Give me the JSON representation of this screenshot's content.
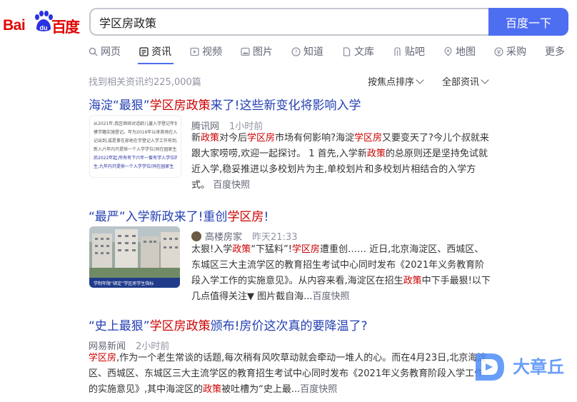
{
  "logo": {
    "text_left": "Bai",
    "text_right": "百度",
    "paw_text": "du"
  },
  "search": {
    "query": "学区房政策",
    "button_label": "百度一下"
  },
  "tabs": [
    {
      "label": "网页",
      "icon": "search-icon"
    },
    {
      "label": "资讯",
      "icon": "news-icon",
      "active": true
    },
    {
      "label": "视频",
      "icon": "video-icon"
    },
    {
      "label": "图片",
      "icon": "image-icon"
    },
    {
      "label": "知道",
      "icon": "question-icon"
    },
    {
      "label": "文库",
      "icon": "document-icon"
    },
    {
      "label": "贴吧",
      "icon": "tieba-icon"
    },
    {
      "label": "地图",
      "icon": "map-icon"
    },
    {
      "label": "采购",
      "icon": "purchase-icon"
    },
    {
      "label": "更多"
    }
  ],
  "result_count": "找到相关资讯约225,000篇",
  "sort_label": "按焦点排序",
  "filter_label": "全部资讯",
  "results": [
    {
      "title_parts": [
        "海淀“最狠”",
        "学区房政策",
        "来了!这些新变化将影响入学"
      ],
      "source": "腾讯网",
      "time": "1小时前",
      "abstract_parts": [
        "新",
        "政策",
        "对今后",
        "学区房",
        "市场有何影响?海淀",
        "学区房",
        "又要变天了?今儿个叔就来跟大家唠唠,欢迎一起探讨。 1 首先,入学新",
        "政策",
        "的总原则还是坚持免试就近入学,稳妥推进以多校划片为主,单校划片和多校划片相结合的入学方式。"
      ],
      "snapshot": "百度快照",
      "thumb_lines": [
        "从2021年,我区继续对适龄儿童入学登记年份",
        "摸学籍实施登记。年为2016年以来首地在入学登",
        "记出到,或是事在部地在学登记入学工作有到,教",
        "新入六年内只提供一个入学学位(同在园家生登记",
        "后2022年起,所有有下六年一套有学入学位的",
        "生,九年内只提供一个入学学位(同在园家生"
      ]
    },
    {
      "title_parts": [
        "“最严”入学新政来了!重创",
        "学区房",
        "!"
      ],
      "source": "高楼房家",
      "time": "昨天21:33",
      "abstract_parts": [
        "太狠!入学",
        "政策",
        "“下猛料”!",
        "学区房",
        "遭重创…… 近日,北京海淀区、西城区、东城区三大主流学区的教育招生考试中心同时发布《2021年义务教育阶段入学工作的实施意见》。从内容来看,海淀区在招生",
        "政策",
        "中下手最狠!以下几点值得关注▼ 图片截自海..."
      ],
      "snapshot": "百度快照",
      "thumb_caption": "学制年限“绑定”学区房学生指标"
    },
    {
      "title_parts": [
        "“史上最狠”",
        "学区房政策",
        "颁布!房价这次真的要降温了?"
      ],
      "source": "网易新闻",
      "time": "2小时前",
      "abstract_parts": [
        "学区房",
        ",作为一个老生常谈的话题,每次稍有风吹草动就会牵动一堆人的心。而在4月23日,北京海淀区、西城区、东城区三大主流学区的教育招生考试中心同时发布《2021年义务教育阶段入学工作的实施意见》,其中海淀区的",
        "政策",
        "被吐槽为“史上最..."
      ],
      "snapshot": "百度快照"
    }
  ],
  "watermark_text": "大章丘",
  "colors": {
    "brand_red": "#e10602",
    "button_blue": "#4e6ef2",
    "title_blue": "#2440b3",
    "highlight_red": "#cc0000"
  }
}
